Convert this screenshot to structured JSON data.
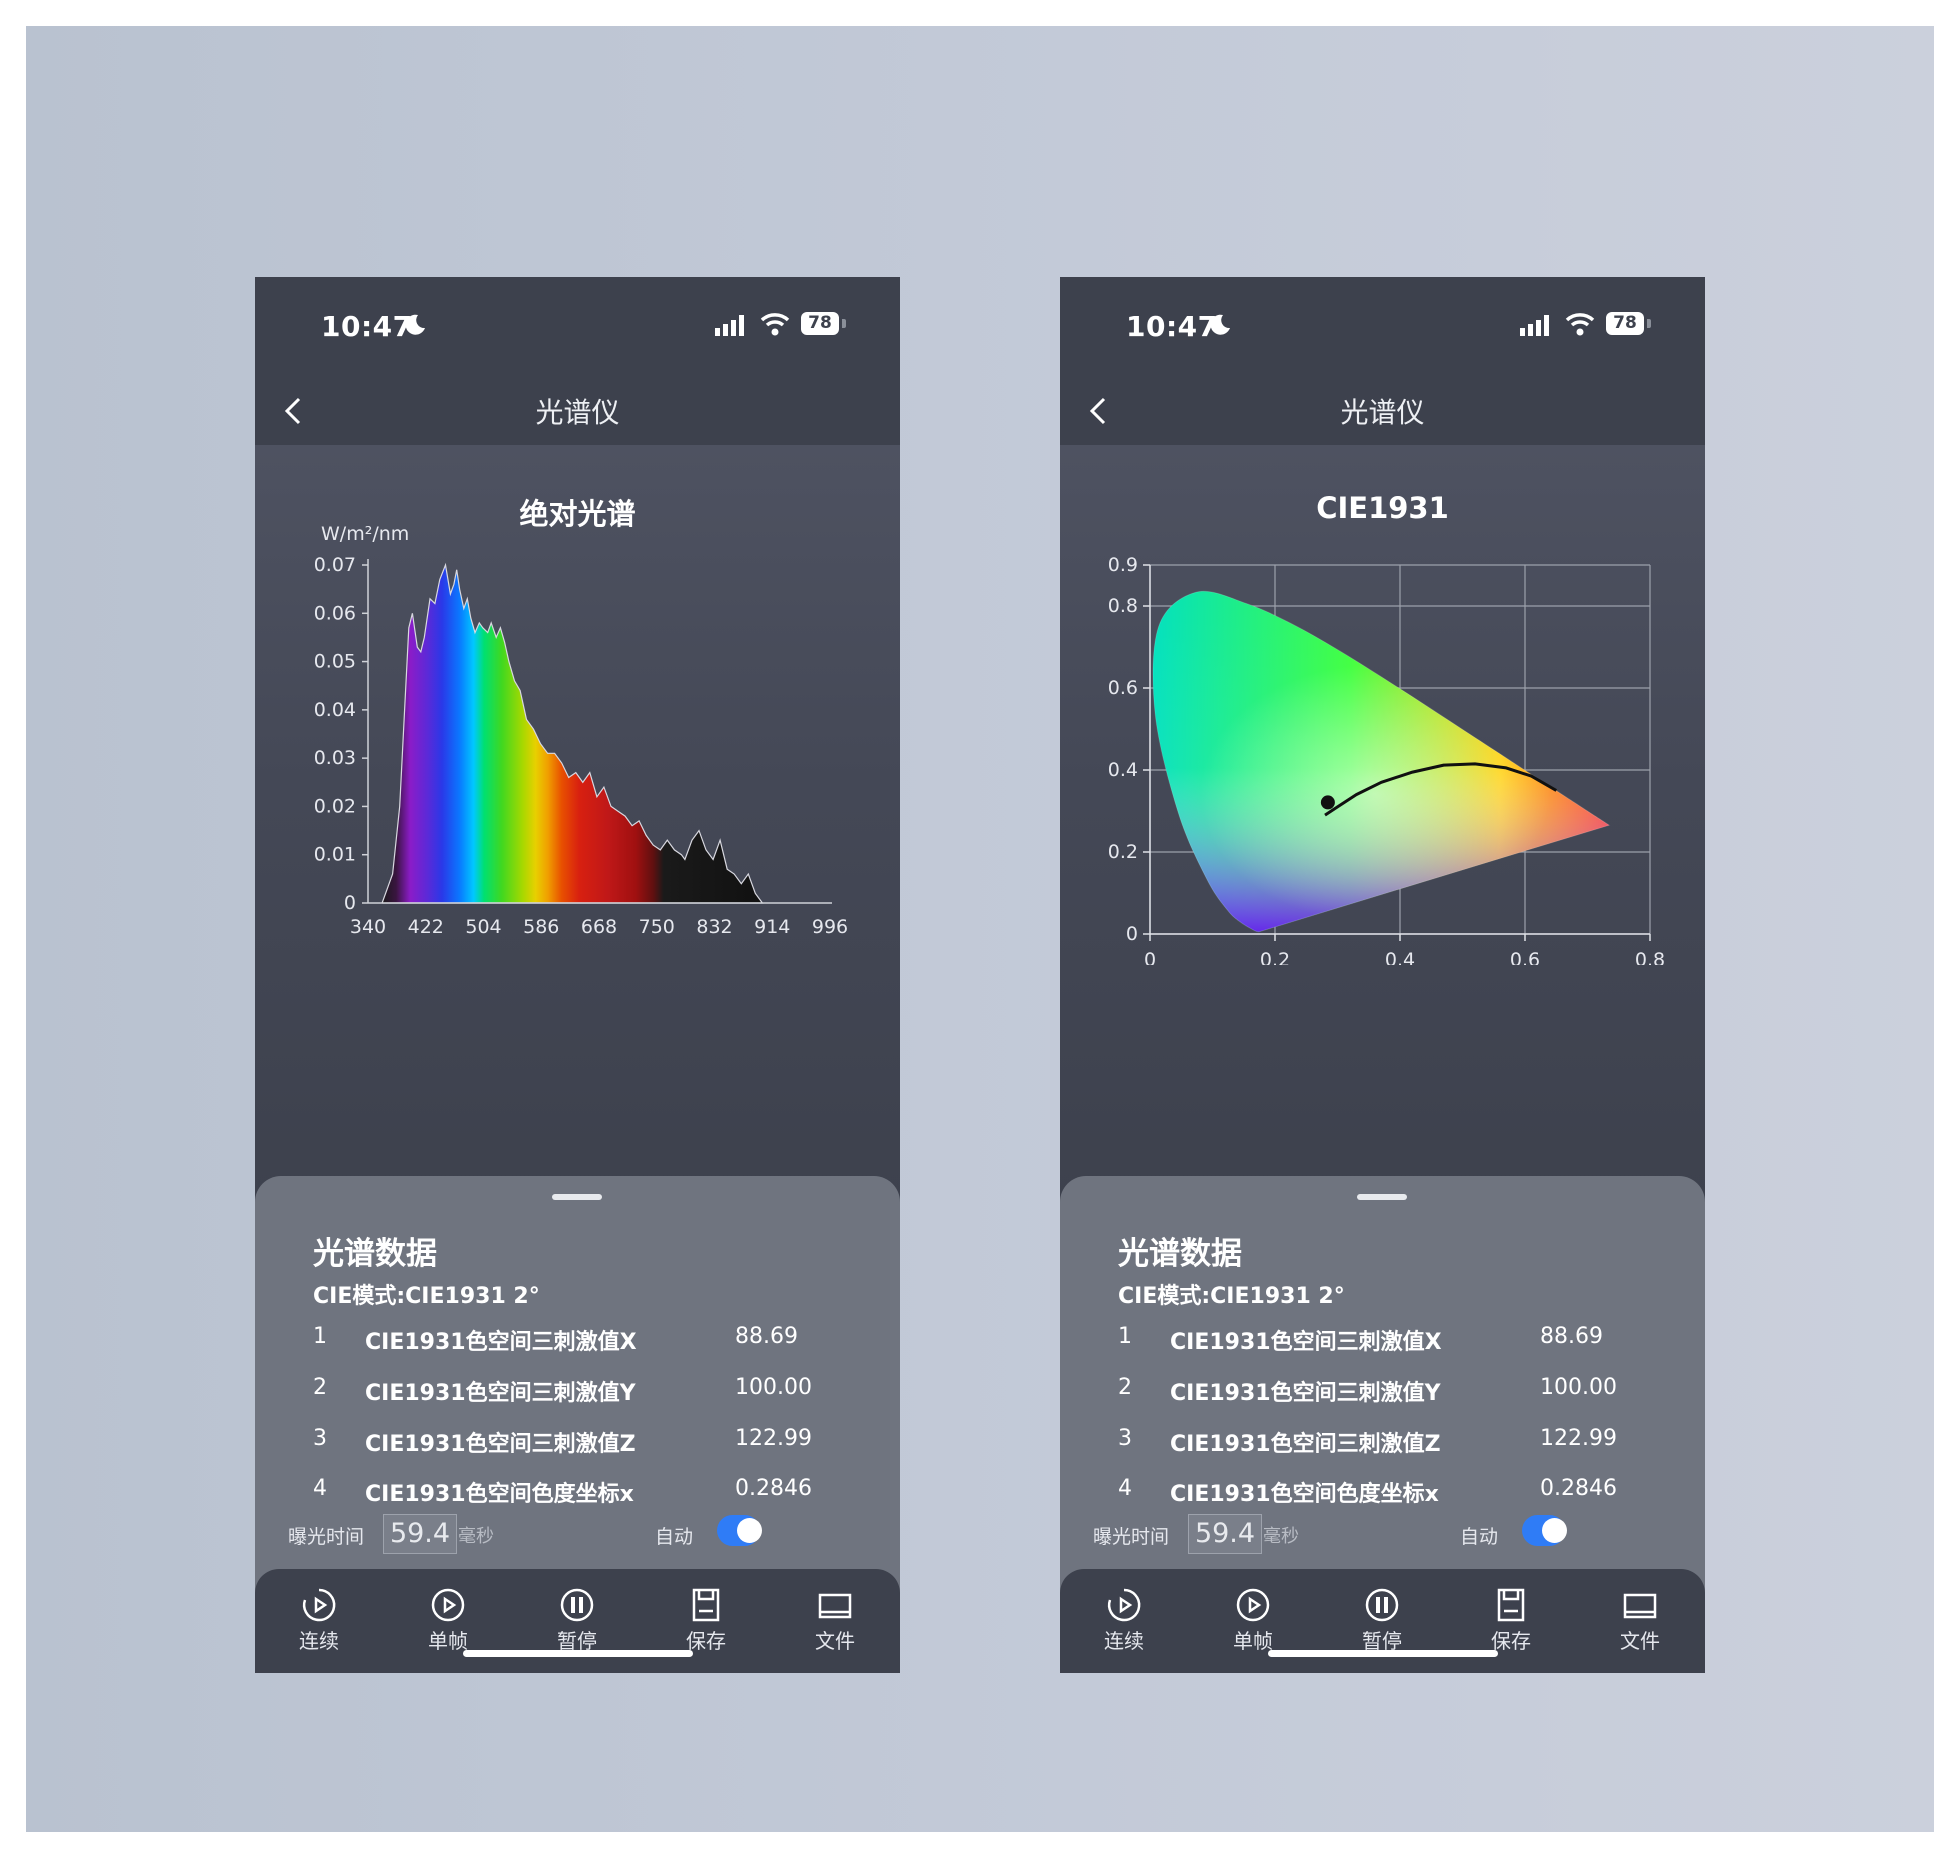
{
  "status": {
    "time": "10:47",
    "battery": "78"
  },
  "nav": {
    "title": "光谱仪"
  },
  "left_chart": {
    "title": "绝对光谱",
    "unit": "W/m²/nm"
  },
  "right_chart": {
    "title": "CIE1931"
  },
  "sheet": {
    "title": "光谱数据",
    "cie_mode": "CIE模式:CIE1931 2°",
    "rows": [
      {
        "index": "1",
        "name": "CIE1931色空间三刺激值X",
        "value": "88.69"
      },
      {
        "index": "2",
        "name": "CIE1931色空间三刺激值Y",
        "value": "100.00"
      },
      {
        "index": "3",
        "name": "CIE1931色空间三刺激值Z",
        "value": "122.99"
      },
      {
        "index": "4",
        "name": "CIE1931色空间色度坐标x",
        "value": "0.2846"
      }
    ],
    "exposure_label": "曝光时间",
    "exposure_value": "59.4",
    "exposure_unit": "毫秒",
    "auto_label": "自动",
    "auto_enabled": true
  },
  "tabs": [
    {
      "label": "连续",
      "icon": "continuous-play-icon"
    },
    {
      "label": "单帧",
      "icon": "play-icon"
    },
    {
      "label": "暂停",
      "icon": "pause-icon"
    },
    {
      "label": "保存",
      "icon": "save-icon"
    },
    {
      "label": "文件",
      "icon": "folder-icon"
    }
  ],
  "colors": {
    "background": "#3d414d",
    "sheet": "#6f747f",
    "toggle": "#2f7cf6"
  },
  "chart_data": [
    {
      "type": "area",
      "title": "绝对光谱",
      "ylabel": "W/m²/nm",
      "xlim": [
        340,
        996
      ],
      "ylim": [
        0,
        0.07
      ],
      "x_ticks": [
        "340",
        "422",
        "504",
        "586",
        "668",
        "750",
        "832",
        "914",
        "996"
      ],
      "y_ticks": [
        "0",
        "0.01",
        "0.02",
        "0.03",
        "0.04",
        "0.05",
        "0.06",
        "0.07"
      ],
      "grid": false,
      "x": [
        360,
        375,
        385,
        392,
        398,
        403,
        410,
        415,
        420,
        428,
        435,
        442,
        450,
        457,
        462,
        466,
        470,
        476,
        481,
        486,
        492,
        498,
        503,
        510,
        515,
        522,
        528,
        534,
        540,
        548,
        556,
        565,
        575,
        585,
        595,
        605,
        615,
        625,
        635,
        645,
        655,
        665,
        675,
        685,
        695,
        705,
        715,
        725,
        735,
        745,
        755,
        765,
        775,
        785,
        790,
        800,
        810,
        820,
        830,
        840,
        850,
        860,
        870,
        880,
        890,
        900
      ],
      "values": [
        0.0,
        0.006,
        0.02,
        0.04,
        0.057,
        0.06,
        0.053,
        0.052,
        0.055,
        0.063,
        0.062,
        0.067,
        0.07,
        0.064,
        0.066,
        0.069,
        0.065,
        0.061,
        0.063,
        0.059,
        0.056,
        0.058,
        0.057,
        0.056,
        0.058,
        0.055,
        0.057,
        0.054,
        0.05,
        0.046,
        0.044,
        0.038,
        0.036,
        0.033,
        0.031,
        0.031,
        0.029,
        0.026,
        0.027,
        0.025,
        0.027,
        0.022,
        0.024,
        0.02,
        0.019,
        0.018,
        0.016,
        0.017,
        0.014,
        0.012,
        0.011,
        0.013,
        0.011,
        0.01,
        0.009,
        0.013,
        0.015,
        0.011,
        0.009,
        0.013,
        0.007,
        0.006,
        0.004,
        0.006,
        0.002,
        0.0
      ]
    },
    {
      "type": "scatter",
      "title": "CIE1931",
      "xlim": [
        0,
        0.8
      ],
      "ylim": [
        0,
        0.9
      ],
      "x_ticks": [
        "0",
        "0.2",
        "0.4",
        "0.6",
        "0.8"
      ],
      "y_ticks": [
        "0",
        "0.2",
        "0.4",
        "0.6",
        "0.8",
        "0.9"
      ],
      "grid": true,
      "gamut_locus": {
        "x": [
          0.1741,
          0.1666,
          0.144,
          0.1241,
          0.0913,
          0.0454,
          0.0082,
          0.0139,
          0.0743,
          0.1547,
          0.2296,
          0.3016,
          0.3731,
          0.4441,
          0.5125,
          0.5752,
          0.627,
          0.6658,
          0.6915,
          0.7079,
          0.7347
        ],
        "y": [
          0.005,
          0.0089,
          0.0297,
          0.0578,
          0.1327,
          0.295,
          0.5384,
          0.7502,
          0.8338,
          0.8059,
          0.7543,
          0.6923,
          0.6245,
          0.5547,
          0.4866,
          0.4242,
          0.3725,
          0.334,
          0.3083,
          0.292,
          0.2653
        ]
      },
      "planckian_locus": {
        "x": [
          0.28,
          0.3,
          0.33,
          0.37,
          0.42,
          0.47,
          0.52,
          0.57,
          0.61,
          0.65
        ],
        "y": [
          0.29,
          0.31,
          0.34,
          0.37,
          0.395,
          0.412,
          0.415,
          0.405,
          0.385,
          0.35
        ]
      },
      "points": [
        {
          "x": 0.2846,
          "y": 0.321
        }
      ]
    }
  ]
}
